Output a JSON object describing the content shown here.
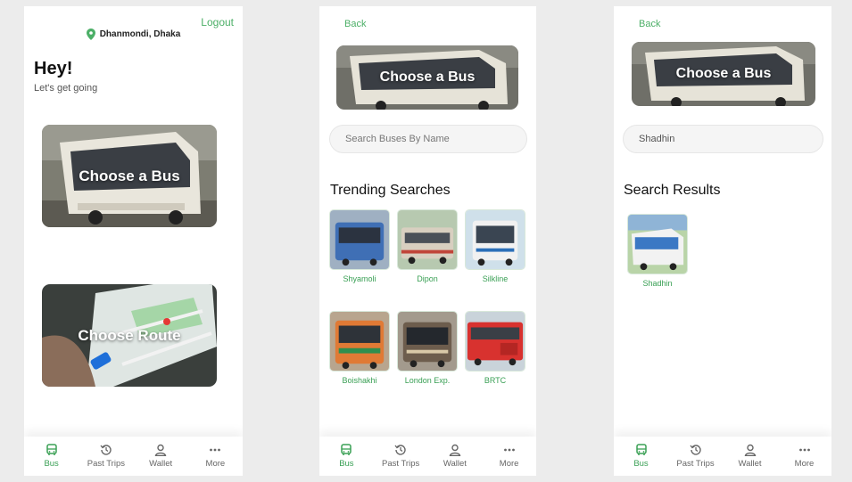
{
  "screen1": {
    "logout": "Logout",
    "location": "Dhanmondi, Dhaka",
    "greeting": "Hey!",
    "subtitle": "Let's get going",
    "card_bus": "Choose a Bus",
    "card_route": "Choose Route"
  },
  "screen2": {
    "back": "Back",
    "hero": "Choose a Bus",
    "search_placeholder": "Search Buses By Name",
    "section": "Trending Searches",
    "buses": [
      {
        "name": "Shyamoli",
        "color": "#3f6fb5"
      },
      {
        "name": "Dipon",
        "color": "#d8cfc0"
      },
      {
        "name": "Silkline",
        "color": "#f1f1f1"
      },
      {
        "name": "Boishakhi",
        "color": "#e07a35"
      },
      {
        "name": "London Exp.",
        "color": "#6d5d4d"
      },
      {
        "name": "BRTC",
        "color": "#d8322f"
      }
    ]
  },
  "screen3": {
    "back": "Back",
    "hero": "Choose a Bus",
    "search_value": "Shadhin",
    "section": "Search Results",
    "results": [
      {
        "name": "Shadhin",
        "color": "#3b78c4"
      }
    ]
  },
  "tabs": {
    "bus": "Bus",
    "past_trips": "Past Trips",
    "wallet": "Wallet",
    "more": "More"
  },
  "colors": {
    "accent": "#3aa055",
    "background": "#ececec"
  }
}
